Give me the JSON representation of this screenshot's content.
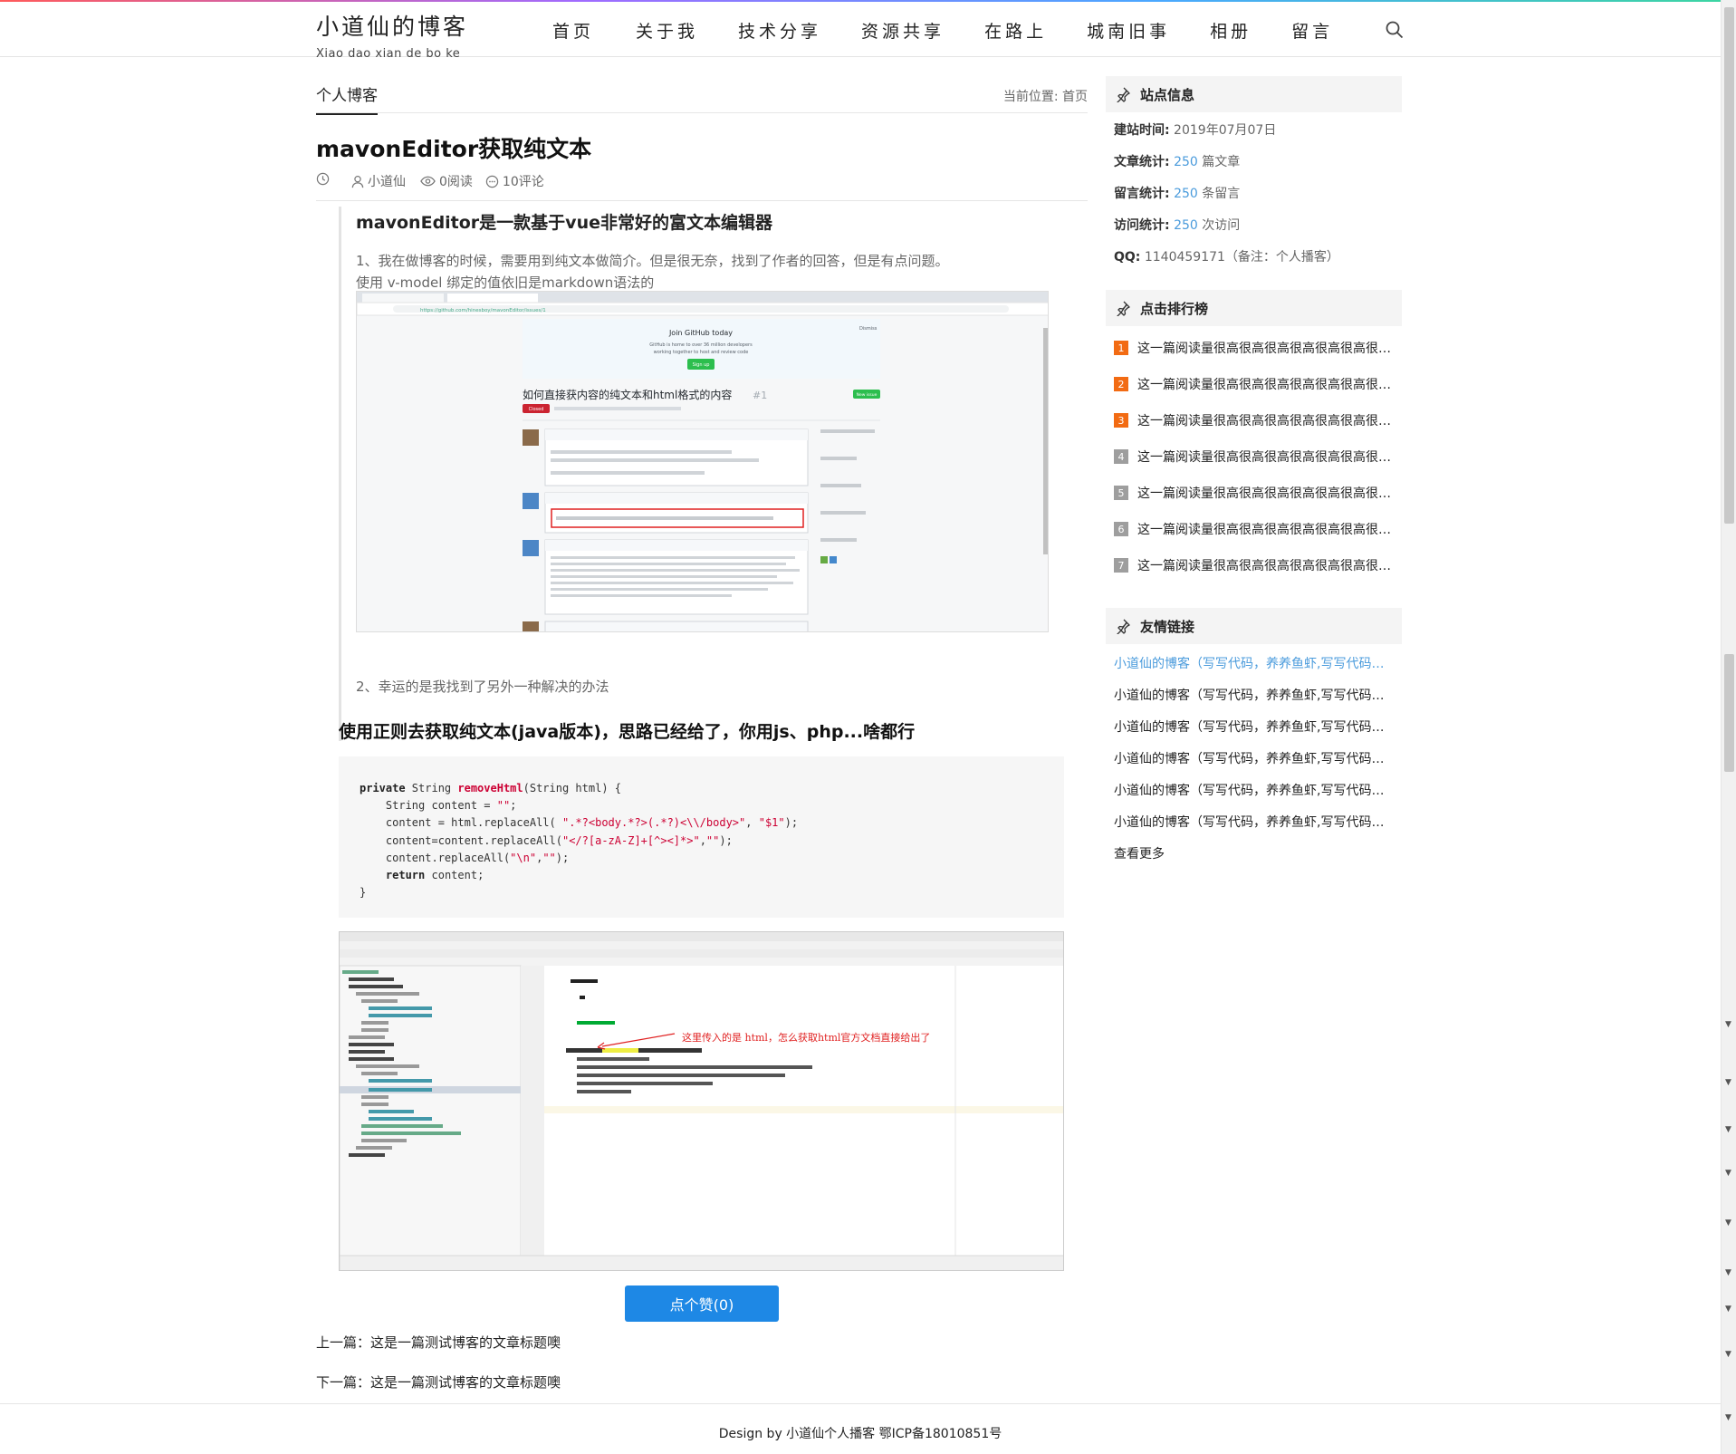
{
  "header": {
    "logo_title": "小道仙的博客",
    "logo_subtitle": "Xiao dao xian de bo ke",
    "nav": [
      "首页",
      "关于我",
      "技术分享",
      "资源共享",
      "在路上",
      "城南旧事",
      "相册",
      "留言"
    ]
  },
  "breadcrumb": {
    "tab": "个人博客",
    "position": "当前位置: 首页"
  },
  "article": {
    "title": "mavonEditor获取纯文本",
    "author": "小道仙",
    "reads": "0阅读",
    "comments": "10评论",
    "heading1": "mavonEditor是一款基于vue非常好的富文本编辑器",
    "para1_line1": "1、我在做博客的时候，需要用到纯文本做简介。但是很无奈，找到了作者的回答，但是有点问题。",
    "para1_line2": "使用 v-model 绑定的值依旧是markdown语法的",
    "para2": "2、幸运的是我找到了另外一种解决的办法",
    "heading2": "使用正则去获取纯文本(java版本)，思路已经给了，你用js、php...啥都行",
    "code_lines": [
      "private String removeHtml(String html) {",
      "    String content = \"\";",
      "    content = html.replaceAll( \".*?<body.*?>(.*?)<\\\\/body>\", \"$1\");",
      "    content=content.replaceAll(\"</?[a-zA-Z]+[^><]*>\",\"\");",
      "    content.replaceAll(\"\\n\",\"\");",
      "    return content;",
      "}"
    ],
    "screenshot1": {
      "banner_title": "Join GitHub today",
      "banner_text": "GitHub is home to over 36 million developers working together to host and review code, manage projects, and build software together.",
      "signup": "Sign up",
      "dismiss": "Dismiss",
      "issue_title": "如何直接获内容的纯文本和html格式的内容",
      "issue_num": "#1",
      "closed": "Closed",
      "new_issue": "New issue",
      "url": "https://github.com/hinesboy/mavonEditor/issues/1"
    },
    "screenshot2": {
      "annotation": "这里传入的是 html，怎么获取html官方文档直接给出了"
    },
    "like_button": "点个赞(0)",
    "prev": "上一篇：这是一篇测试博客的文章标题噢",
    "next": "下一篇：这是一篇测试博客的文章标题噢"
  },
  "sidebar": {
    "site_info": {
      "title": "站点信息",
      "rows": [
        {
          "label": "建站时间:",
          "value": " 2019年07月07日",
          "num": "",
          "suffix": ""
        },
        {
          "label": "文章统计:",
          "value": " ",
          "num": "250",
          "suffix": " 篇文章"
        },
        {
          "label": "留言统计:",
          "value": " ",
          "num": "250",
          "suffix": " 条留言"
        },
        {
          "label": "访问统计:",
          "value": " ",
          "num": "250",
          "suffix": " 次访问"
        },
        {
          "label": "QQ:",
          "value": " 1140459171（备注：个人播客）",
          "num": "",
          "suffix": ""
        }
      ]
    },
    "ranking": {
      "title": "点击排行榜",
      "items": [
        {
          "num": "1",
          "text": "这一篇阅读量很高很高很高很高很高很高很高很高很高"
        },
        {
          "num": "2",
          "text": "这一篇阅读量很高很高很高很高很高很高很高很高很高"
        },
        {
          "num": "3",
          "text": "这一篇阅读量很高很高很高很高很高很高很高很高很高"
        },
        {
          "num": "4",
          "text": "这一篇阅读量很高很高很高很高很高很高很高很高很高"
        },
        {
          "num": "5",
          "text": "这一篇阅读量很高很高很高很高很高很高很高很高很高"
        },
        {
          "num": "6",
          "text": "这一篇阅读量很高很高很高很高很高很高很高很高很高"
        },
        {
          "num": "7",
          "text": "这一篇阅读量很高很高很高很高很高很高很高很高很高"
        }
      ]
    },
    "links": {
      "title": "友情链接",
      "items": [
        "小道仙的博客（写写代码，养养鱼虾,写写代码，养养鱼虾）",
        "小道仙的博客（写写代码，养养鱼虾,写写代码，养养鱼虾）",
        "小道仙的博客（写写代码，养养鱼虾,写写代码，养养鱼虾）",
        "小道仙的博客（写写代码，养养鱼虾,写写代码，养养鱼虾）",
        "小道仙的博客（写写代码，养养鱼虾,写写代码，养养鱼虾）",
        "小道仙的博客（写写代码，养养鱼虾,写写代码，养养鱼虾）"
      ],
      "more": "查看更多"
    }
  },
  "footer": {
    "text": "Design by 小道仙个人播客 鄂ICP备18010851号"
  },
  "colors": {
    "accent_blue": "#1e88e5",
    "link_blue": "#4a9bdc",
    "rank_hot": "#f26b13",
    "rank_normal": "#9e9e9e"
  }
}
